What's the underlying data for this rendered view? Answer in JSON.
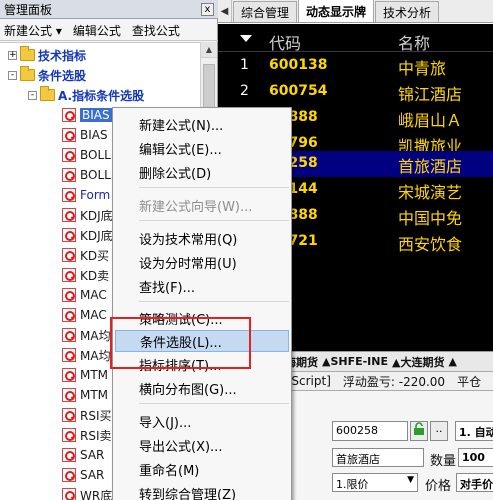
{
  "left_panel": {
    "title": "管理面板",
    "close_glyph": "x",
    "toolbar": {
      "new_formula": "新建公式",
      "edit_formula": "编辑公式",
      "find_formula": "查找公式",
      "dropdown_glyph": "▾"
    },
    "tree": {
      "nodes": [
        {
          "label": "技术指标",
          "expander": "+"
        },
        {
          "label": "条件选股",
          "expander": "-"
        },
        {
          "label": "A.指标条件选股",
          "expander": "-"
        }
      ],
      "items": [
        {
          "label": "BIAS",
          "selected": true
        },
        {
          "label": "BIAS"
        },
        {
          "label": "BOLL"
        },
        {
          "label": "BOLL"
        },
        {
          "label": "Form",
          "blue": true
        },
        {
          "label": "KDJ底"
        },
        {
          "label": "KDJ底"
        },
        {
          "label": "KD买"
        },
        {
          "label": "KD卖"
        },
        {
          "label": "MAC"
        },
        {
          "label": "MAC"
        },
        {
          "label": "MA均"
        },
        {
          "label": "MA均"
        },
        {
          "label": "MTM"
        },
        {
          "label": "MTM"
        },
        {
          "label": "RSI买"
        },
        {
          "label": "RSI卖"
        },
        {
          "label": "SAR"
        },
        {
          "label": "SAR"
        },
        {
          "label": "WR底"
        }
      ]
    },
    "scroll_up": "▲"
  },
  "right_panel": {
    "tab_nav": "◀",
    "tabs": [
      "综合管理",
      "动态显示牌",
      "技术分析"
    ],
    "active_tab_index": 1,
    "quote_table": {
      "headers": {
        "code": "代码",
        "name": "名称"
      },
      "sort_glyph": "▼",
      "rows": [
        {
          "num": "1",
          "code": "600138",
          "name": "中青旅"
        },
        {
          "num": "2",
          "code": "600754",
          "name": "锦江酒店"
        },
        {
          "num": "",
          "code": "00888",
          "name": "峨眉山Ａ"
        },
        {
          "num": "",
          "code": "00796",
          "name": "凯撒旅业"
        },
        {
          "num": "",
          "code": "00258",
          "name": "首旅酒店",
          "highlighted": true
        },
        {
          "num": "",
          "code": "00144",
          "name": "宋城演艺"
        },
        {
          "num": "",
          "code": "01888",
          "name": "中国中免"
        },
        {
          "num": "",
          "code": "00721",
          "name": "西安饮食"
        }
      ]
    },
    "futures_tabs": [
      "海期货",
      "▲SHFE-INE",
      "▲大连期货",
      "▲"
    ],
    "status_strip": {
      "script": "eScript]",
      "floating_pnl": "浮动盈亏: -220.00",
      "more": "平仓"
    },
    "order_panel": {
      "code": "600258",
      "lock_glyph": "🔒",
      "more_button": "..",
      "auto_option": "1. 自动",
      "name": "首旅酒店",
      "qty_label": "数量",
      "qty_value": "100",
      "order_type": "1.限价",
      "price_label": "价格",
      "price_value": "对手价"
    }
  },
  "context_menu": {
    "items": [
      {
        "label": "新建公式(N)..."
      },
      {
        "label": "编辑公式(E)..."
      },
      {
        "label": "删除公式(D)"
      },
      {
        "label": "新建公式向导(W)...",
        "disabled": true
      },
      {
        "label": "设为技术常用(Q)"
      },
      {
        "label": "设为分时常用(U)"
      },
      {
        "label": "查找(F)..."
      },
      {
        "label": "策略测试(C)..."
      },
      {
        "label": "条件选股(L)...",
        "hover": true
      },
      {
        "label": "指标排序(T)..."
      },
      {
        "label": "横向分布图(G)..."
      },
      {
        "label": "导入(J)..."
      },
      {
        "label": "导出公式(X)..."
      },
      {
        "label": "重命名(M)"
      },
      {
        "label": "转到综合管理(Z)"
      }
    ]
  },
  "colors": {
    "quote_bg": "#000000",
    "quote_code": "#ffd700",
    "quote_highlight": "#000080",
    "menu_hover": "#c4daf2",
    "annotation_box": "#e22222"
  }
}
